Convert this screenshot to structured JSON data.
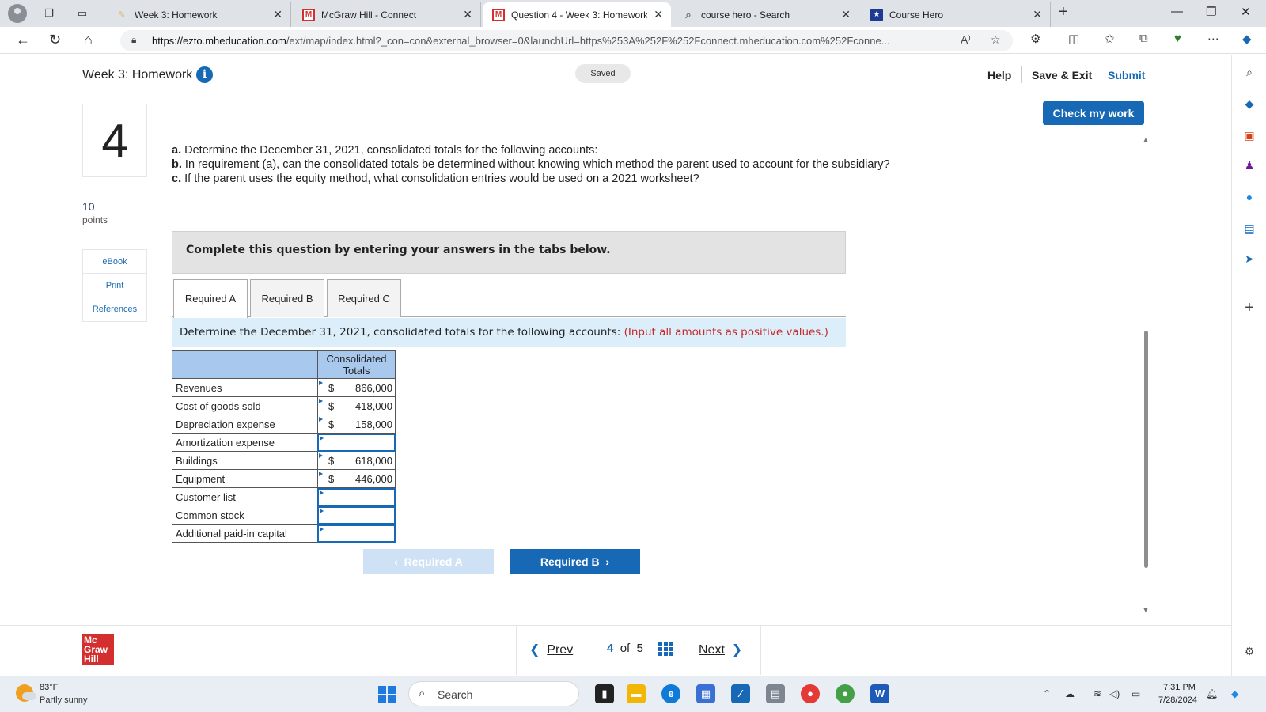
{
  "browser": {
    "tabs": [
      {
        "title": "Week 3: Homework",
        "favicon": "homework-icon"
      },
      {
        "title": "McGraw Hill - Connect",
        "favicon": "M"
      },
      {
        "title": "Question 4 - Week 3: Homework",
        "favicon": "M"
      },
      {
        "title": "course hero - Search",
        "favicon": "search-icon"
      },
      {
        "title": "Course Hero",
        "favicon": "star-icon"
      }
    ],
    "active_tab": 2,
    "url_domain": "https://ezto.mheducation.com",
    "url_path": "/ext/map/index.html?_con=con&external_browser=0&launchUrl=https%253A%252F%252Fconnect.mheducation.com%252Fconne..."
  },
  "header": {
    "title": "Week 3: Homework",
    "saved": "Saved",
    "help": "Help",
    "save_exit": "Save & Exit",
    "submit": "Submit"
  },
  "question": {
    "number": "4",
    "points_value": "10",
    "points_label": "points",
    "side_links": [
      "eBook",
      "Print",
      "References"
    ],
    "check_button": "Check my work",
    "parts": [
      {
        "label": "a.",
        "text": "Determine the December 31, 2021, consolidated totals for the following accounts:"
      },
      {
        "label": "b.",
        "text": "In requirement (a), can the consolidated totals be determined without knowing which method the parent used to account for the subsidiary?"
      },
      {
        "label": "c.",
        "text": "If the parent uses the equity method, what consolidation entries would be used on a 2021 worksheet?"
      }
    ],
    "instruction": "Complete this question by entering your answers in the tabs below.",
    "tabs": [
      "Required A",
      "Required B",
      "Required C"
    ],
    "active_tab": 0,
    "req_heading": "Determine the December 31, 2021, consolidated totals for the following accounts:",
    "req_note": "(Input all amounts as positive values.)",
    "table": {
      "col_header": "Consolidated Totals",
      "rows": [
        {
          "account": "Revenues",
          "symbol": "$",
          "value": "866,000"
        },
        {
          "account": "Cost of goods sold",
          "symbol": "$",
          "value": "418,000"
        },
        {
          "account": "Depreciation expense",
          "symbol": "$",
          "value": "158,000"
        },
        {
          "account": "Amortization expense",
          "symbol": "",
          "value": ""
        },
        {
          "account": "Buildings",
          "symbol": "$",
          "value": "618,000"
        },
        {
          "account": "Equipment",
          "symbol": "$",
          "value": "446,000"
        },
        {
          "account": "Customer list",
          "symbol": "",
          "value": ""
        },
        {
          "account": "Common stock",
          "symbol": "",
          "value": ""
        },
        {
          "account": "Additional paid-in capital",
          "symbol": "",
          "value": ""
        }
      ]
    },
    "nav_prev": "Required A",
    "nav_next": "Required B"
  },
  "footer": {
    "logo": [
      "Mc",
      "Graw",
      "Hill"
    ],
    "prev": "Prev",
    "current": "4",
    "of": "of",
    "total": "5",
    "next": "Next"
  },
  "taskbar": {
    "temp": "83°F",
    "weather": "Partly sunny",
    "search_placeholder": "Search",
    "time": "7:31 PM",
    "date": "7/28/2024"
  }
}
